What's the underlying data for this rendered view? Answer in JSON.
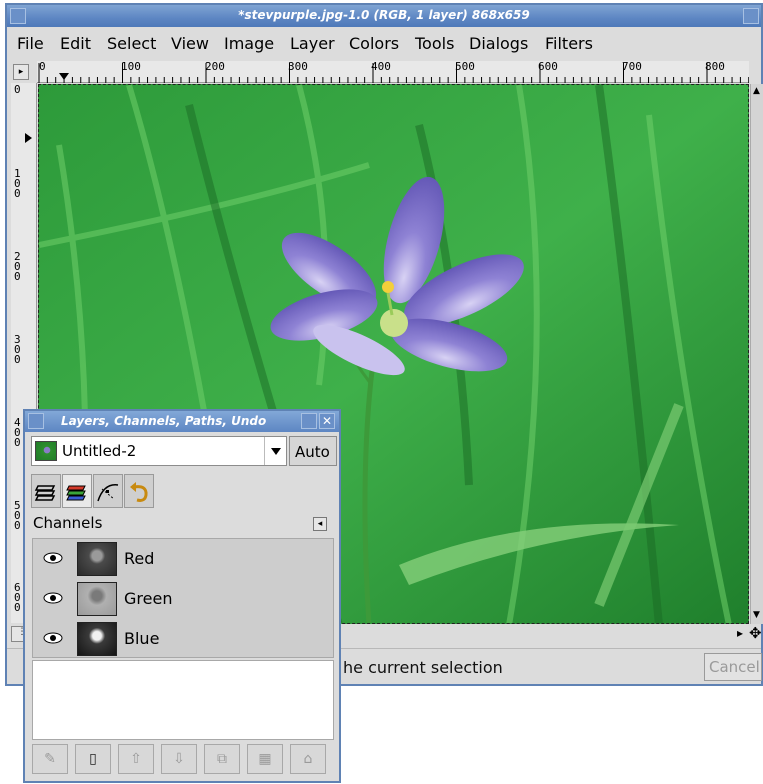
{
  "window": {
    "title": "*stevpurple.jpg-1.0 (RGB, 1 layer) 868x659"
  },
  "menubar": {
    "items": [
      "File",
      "Edit",
      "Select",
      "View",
      "Image",
      "Layer",
      "Colors",
      "Tools",
      "Dialogs",
      "Filters"
    ]
  },
  "rulers": {
    "horizontal_ticks": [
      "0",
      "100",
      "200",
      "300",
      "400",
      "500",
      "600",
      "700",
      "800"
    ],
    "vertical_ticks": [
      "0",
      "100",
      "200",
      "300",
      "400",
      "500",
      "600"
    ]
  },
  "statusbar": {
    "text": "he current selection",
    "cancel_label": "Cancel"
  },
  "dock": {
    "title": "Layers, Channels, Paths, Undo",
    "image_name": "Untitled-2",
    "auto_label": "Auto",
    "tabs": [
      {
        "icon": "layers-icon"
      },
      {
        "icon": "channels-icon"
      },
      {
        "icon": "paths-icon"
      },
      {
        "icon": "undo-icon"
      }
    ],
    "section_title": "Channels",
    "channels": [
      {
        "name": "Red"
      },
      {
        "name": "Green"
      },
      {
        "name": "Blue"
      }
    ],
    "buttons": [
      {
        "icon": "edit-channel-icon"
      },
      {
        "icon": "new-channel-icon"
      },
      {
        "icon": "raise-channel-icon"
      },
      {
        "icon": "lower-channel-icon"
      },
      {
        "icon": "duplicate-channel-icon"
      },
      {
        "icon": "channel-to-selection-icon"
      },
      {
        "icon": "delete-channel-icon"
      }
    ]
  }
}
